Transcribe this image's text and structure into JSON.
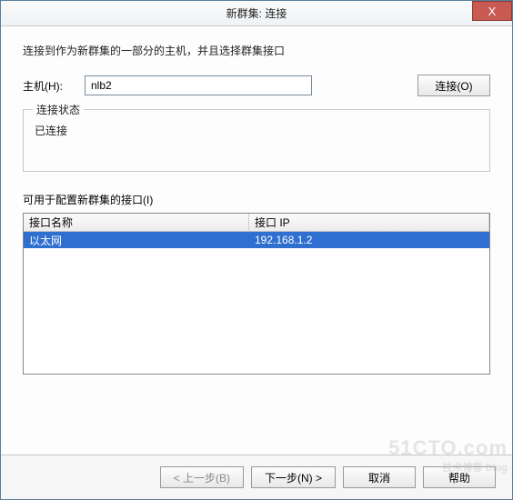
{
  "window": {
    "title": "新群集: 连接",
    "close_glyph": "X"
  },
  "instruction": "连接到作为新群集的一部分的主机，并且选择群集接口",
  "host": {
    "label": "主机(H):",
    "value": "nlb2",
    "connect_btn": "连接(O)"
  },
  "status_group": {
    "title": "连接状态",
    "text": "已连接"
  },
  "interfaces": {
    "label": "可用于配置新群集的接口(I)",
    "columns": {
      "name": "接口名称",
      "ip": "接口 IP"
    },
    "rows": [
      {
        "name": "以太网",
        "ip": "192.168.1.2",
        "selected": true
      }
    ]
  },
  "footer": {
    "back": "< 上一步(B)",
    "next": "下一步(N) >",
    "cancel": "取消",
    "help": "帮助"
  },
  "watermark": {
    "main": "51CTO.com",
    "sub": "技术博客 Blog"
  }
}
